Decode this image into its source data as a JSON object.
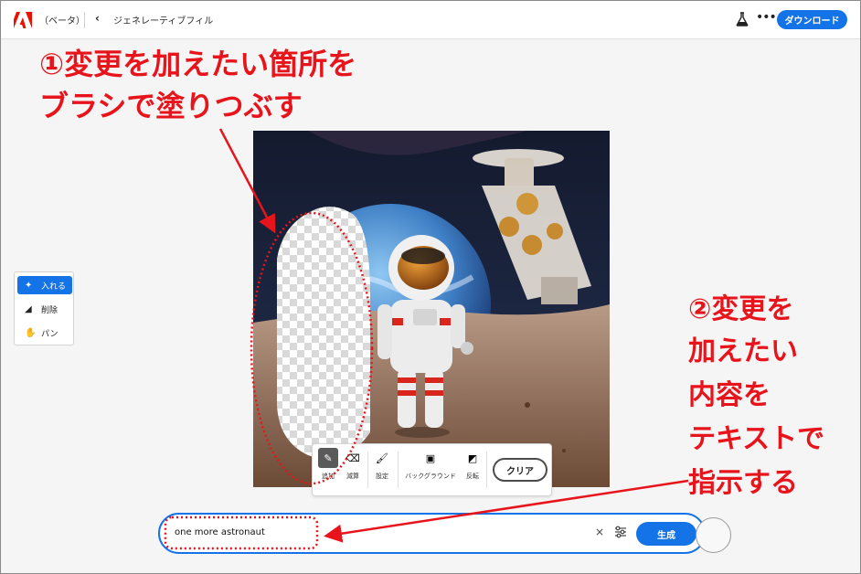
{
  "header": {
    "beta_label": "（ベータ）",
    "app_name": "ジェネレーティブフィル",
    "more_label": "•••",
    "download_label": "ダウンロード"
  },
  "annotations": {
    "step1_line1": "①変更を加えたい箇所を",
    "step1_line2": "ブラシで塗りつぶす",
    "step2_line1": "②変更を",
    "step2_line2": "加えたい",
    "step2_line3": "内容を",
    "step2_line4": "テキストで",
    "step2_line5": "指示する"
  },
  "tools": [
    {
      "label": "入れる",
      "icon": "insert-brush-icon",
      "active": true
    },
    {
      "label": "削除",
      "icon": "remove-eraser-icon",
      "active": false
    },
    {
      "label": "パン",
      "icon": "hand-pan-icon",
      "active": false
    }
  ],
  "brush_toolbar": {
    "add_label": "追加",
    "subtract_label": "減算",
    "settings_label": "設定",
    "background_label": "バックグラウンド",
    "invert_label": "反転",
    "clear_label": "クリア"
  },
  "prompt": {
    "value": "one more astronaut",
    "generate_label": "生成",
    "clear_symbol": "×"
  },
  "colors": {
    "accent": "#1473e6",
    "annotation_red": "#e8141b",
    "adobe_red": "#eb1000"
  }
}
